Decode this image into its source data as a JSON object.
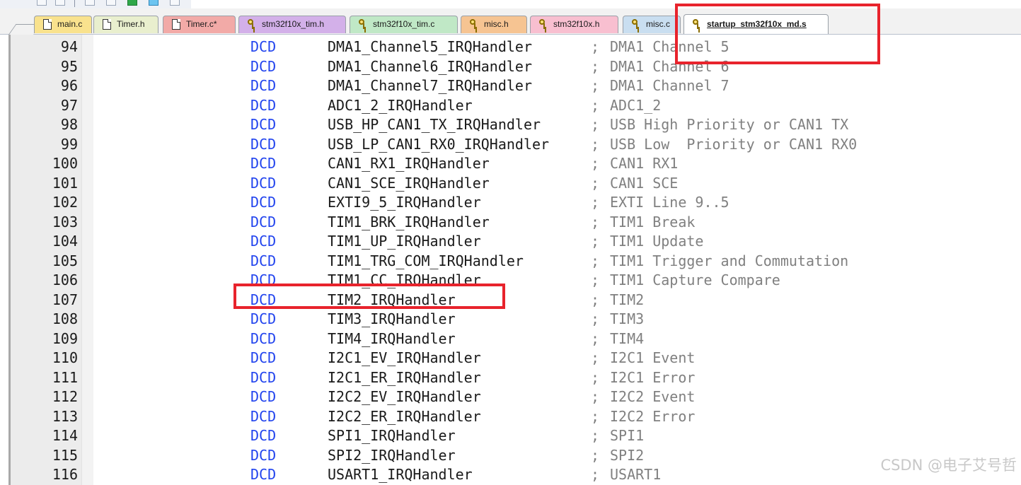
{
  "tabs": [
    {
      "id": "t-main",
      "label": "main.c",
      "icon": "document-icon",
      "active": false
    },
    {
      "id": "t-timh",
      "label": "Timer.h",
      "icon": "document-icon",
      "active": false
    },
    {
      "id": "t-timc",
      "label": "Timer.c*",
      "icon": "document-icon",
      "active": false
    },
    {
      "id": "t-s1",
      "label": "stm32f10x_tim.h",
      "icon": "locked-file-icon",
      "active": false
    },
    {
      "id": "t-s2",
      "label": "stm32f10x_tim.c",
      "icon": "locked-file-icon",
      "active": false
    },
    {
      "id": "t-misch",
      "label": "misc.h",
      "icon": "locked-file-icon",
      "active": false
    },
    {
      "id": "t-stmh",
      "label": "stm32f10x.h",
      "icon": "locked-file-icon",
      "active": false
    },
    {
      "id": "t-miscc",
      "label": "misc.c",
      "icon": "locked-file-icon",
      "active": false
    },
    {
      "id": "t-start",
      "label": "startup_stm32f10x_md.s",
      "icon": "locked-file-icon",
      "active": true
    }
  ],
  "code_lines": [
    {
      "ln": "94",
      "kw": "DCD",
      "sym": "DMA1_Channel5_IRQHandler",
      "semi": ";",
      "cmt": "DMA1 Channel 5"
    },
    {
      "ln": "95",
      "kw": "DCD",
      "sym": "DMA1_Channel6_IRQHandler",
      "semi": ";",
      "cmt": "DMA1 Channel 6"
    },
    {
      "ln": "96",
      "kw": "DCD",
      "sym": "DMA1_Channel7_IRQHandler",
      "semi": ";",
      "cmt": "DMA1 Channel 7"
    },
    {
      "ln": "97",
      "kw": "DCD",
      "sym": "ADC1_2_IRQHandler",
      "semi": ";",
      "cmt": "ADC1_2"
    },
    {
      "ln": "98",
      "kw": "DCD",
      "sym": "USB_HP_CAN1_TX_IRQHandler",
      "semi": ";",
      "cmt": "USB High Priority or CAN1 TX"
    },
    {
      "ln": "99",
      "kw": "DCD",
      "sym": "USB_LP_CAN1_RX0_IRQHandler",
      "semi": ";",
      "cmt": "USB Low  Priority or CAN1 RX0"
    },
    {
      "ln": "100",
      "kw": "DCD",
      "sym": "CAN1_RX1_IRQHandler",
      "semi": ";",
      "cmt": "CAN1 RX1"
    },
    {
      "ln": "101",
      "kw": "DCD",
      "sym": "CAN1_SCE_IRQHandler",
      "semi": ";",
      "cmt": "CAN1 SCE"
    },
    {
      "ln": "102",
      "kw": "DCD",
      "sym": "EXTI9_5_IRQHandler",
      "semi": ";",
      "cmt": "EXTI Line 9..5"
    },
    {
      "ln": "103",
      "kw": "DCD",
      "sym": "TIM1_BRK_IRQHandler",
      "semi": ";",
      "cmt": "TIM1 Break"
    },
    {
      "ln": "104",
      "kw": "DCD",
      "sym": "TIM1_UP_IRQHandler",
      "semi": ";",
      "cmt": "TIM1 Update"
    },
    {
      "ln": "105",
      "kw": "DCD",
      "sym": "TIM1_TRG_COM_IRQHandler",
      "semi": ";",
      "cmt": "TIM1 Trigger and Commutation"
    },
    {
      "ln": "106",
      "kw": "DCD",
      "sym": "TIM1_CC_IRQHandler",
      "semi": ";",
      "cmt": "TIM1 Capture Compare"
    },
    {
      "ln": "107",
      "kw": "DCD",
      "sym": "TIM2_IRQHandler",
      "semi": ";",
      "cmt": "TIM2"
    },
    {
      "ln": "108",
      "kw": "DCD",
      "sym": "TIM3_IRQHandler",
      "semi": ";",
      "cmt": "TIM3"
    },
    {
      "ln": "109",
      "kw": "DCD",
      "sym": "TIM4_IRQHandler",
      "semi": ";",
      "cmt": "TIM4"
    },
    {
      "ln": "110",
      "kw": "DCD",
      "sym": "I2C1_EV_IRQHandler",
      "semi": ";",
      "cmt": "I2C1 Event"
    },
    {
      "ln": "111",
      "kw": "DCD",
      "sym": "I2C1_ER_IRQHandler",
      "semi": ";",
      "cmt": "I2C1 Error"
    },
    {
      "ln": "112",
      "kw": "DCD",
      "sym": "I2C2_EV_IRQHandler",
      "semi": ";",
      "cmt": "I2C2 Event"
    },
    {
      "ln": "113",
      "kw": "DCD",
      "sym": "I2C2_ER_IRQHandler",
      "semi": ";",
      "cmt": "I2C2 Error"
    },
    {
      "ln": "114",
      "kw": "DCD",
      "sym": "SPI1_IRQHandler",
      "semi": ";",
      "cmt": "SPI1"
    },
    {
      "ln": "115",
      "kw": "DCD",
      "sym": "SPI2_IRQHandler",
      "semi": ";",
      "cmt": "SPI2"
    },
    {
      "ln": "116",
      "kw": "DCD",
      "sym": "USART1_IRQHandler",
      "semi": ";",
      "cmt": "USART1"
    }
  ],
  "watermark": "CSDN @电子艾号哲",
  "colors": {
    "keyword": "#2244ee",
    "comment": "#808080",
    "highlight": "#e8232c"
  }
}
